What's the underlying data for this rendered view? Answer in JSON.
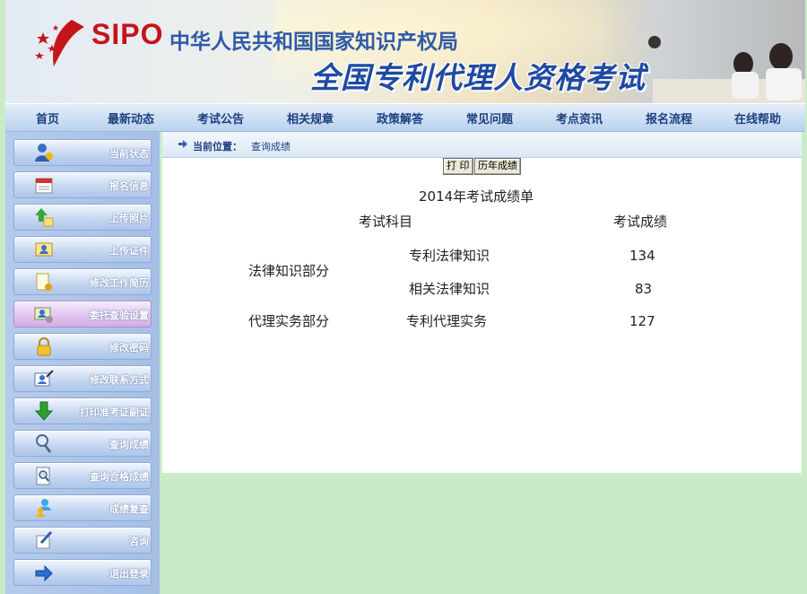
{
  "header": {
    "logo_text": "SIPO",
    "org_name": "中华人民共和国国家知识产权局",
    "exam_title": "全国专利代理人资格考试"
  },
  "nav": {
    "items": [
      "首页",
      "最新动态",
      "考试公告",
      "相关规章",
      "政策解答",
      "常见问题",
      "考点资讯",
      "报名流程",
      "在线帮助"
    ]
  },
  "sidebar": {
    "items": [
      {
        "label": "当前状态",
        "icon": "user-status-icon"
      },
      {
        "label": "报名信息",
        "icon": "calendar-icon"
      },
      {
        "label": "上传照片",
        "icon": "upload-photo-icon"
      },
      {
        "label": "上传证件",
        "icon": "id-card-icon"
      },
      {
        "label": "修改工作简历",
        "icon": "edit-document-icon"
      },
      {
        "label": "委托查验设置",
        "icon": "id-card-settings-icon",
        "active": true
      },
      {
        "label": "修改密码",
        "icon": "lock-icon"
      },
      {
        "label": "修改联系方式",
        "icon": "edit-contact-icon"
      },
      {
        "label": "打印准考证副证",
        "icon": "download-arrow-icon"
      },
      {
        "label": "查询成绩",
        "icon": "magnifier-icon"
      },
      {
        "label": "查询合格成绩",
        "icon": "search-document-icon"
      },
      {
        "label": "成绩复查",
        "icon": "users-review-icon"
      },
      {
        "label": "咨询",
        "icon": "pen-note-icon"
      },
      {
        "label": "退出登录",
        "icon": "logout-arrow-icon"
      }
    ]
  },
  "breadcrumb": {
    "label": "当前位置：",
    "value": "查询成绩"
  },
  "toolbar": {
    "print_label": "打 印",
    "history_label": "历年成绩"
  },
  "scores": {
    "title": "2014年考试成绩单",
    "col_subject": "考试科目",
    "col_score": "考试成绩",
    "groups": [
      {
        "name": "法律知识部分",
        "rows": [
          {
            "subject": "专利法律知识",
            "score": "134"
          },
          {
            "subject": "相关法律知识",
            "score": "83"
          }
        ]
      },
      {
        "name": "代理实务部分",
        "rows": [
          {
            "subject": "专利代理实务",
            "score": "127"
          }
        ]
      }
    ]
  },
  "colors": {
    "page_bg": "#c9ecc6",
    "nav_text": "#1d3f7f",
    "logo_red": "#c4141c",
    "title_blue": "#1f4aa3"
  }
}
